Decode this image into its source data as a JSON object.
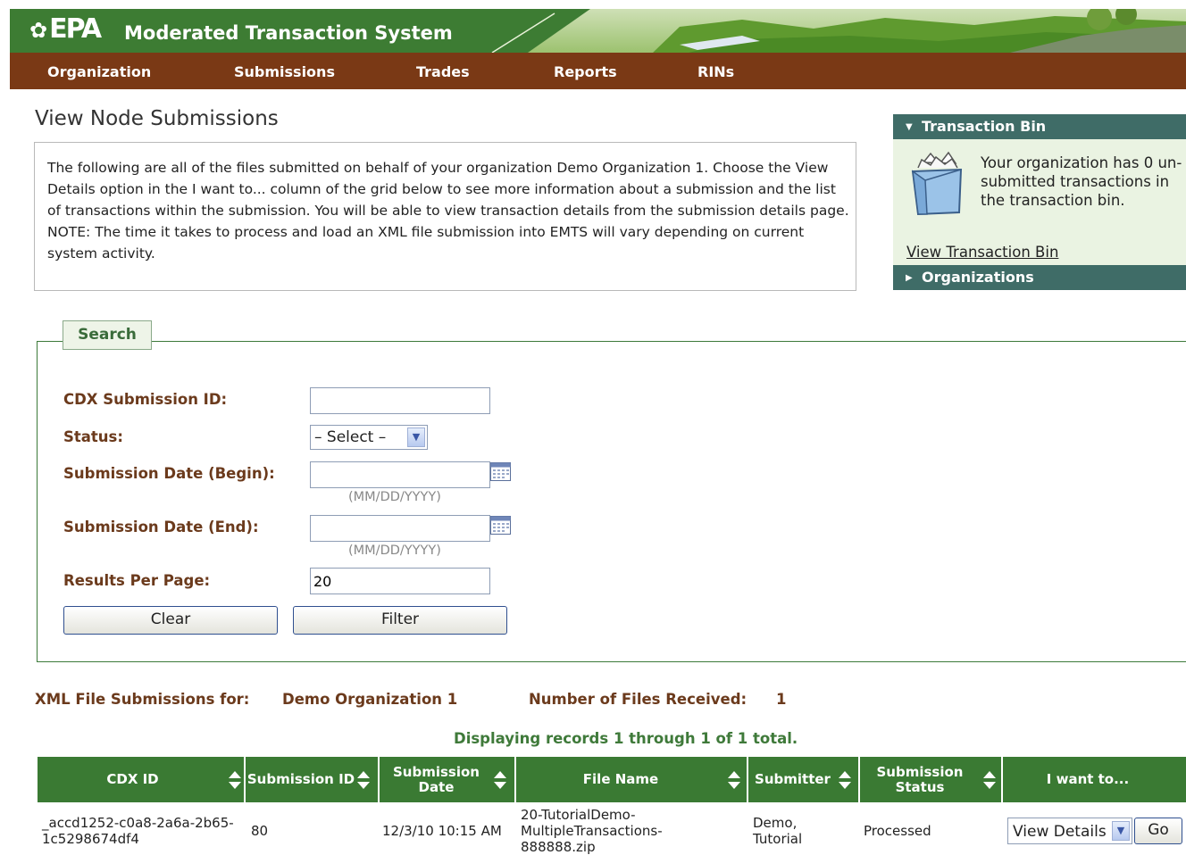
{
  "header": {
    "logo_text": "EPA",
    "app_title": "Moderated Transaction System"
  },
  "nav": {
    "items": [
      {
        "label": "Organization"
      },
      {
        "label": "Submissions"
      },
      {
        "label": "Trades"
      },
      {
        "label": "Reports"
      },
      {
        "label": "RINs"
      }
    ]
  },
  "page": {
    "title": "View Node Submissions",
    "intro": "The following are all of the files submitted on behalf of your organization Demo Organization 1. Choose the View Details option in the I want to... column of the grid below to see more information about a submission and the list of transactions within the submission. You will be able to view transaction details from the submission details page. NOTE: The time it takes to process and load an XML file submission into EMTS will vary depending on current system activity."
  },
  "sidebar": {
    "transaction_bin": {
      "title": "Transaction Bin",
      "message": "Your organization has 0 un-submitted transactions in the transaction bin.",
      "link": "View Transaction Bin"
    },
    "organizations": {
      "title": "Organizations"
    }
  },
  "search": {
    "legend": "Search",
    "cdx_label": "CDX Submission ID:",
    "cdx_value": "",
    "status_label": "Status:",
    "status_value": "– Select –",
    "begin_label": "Submission Date (Begin):",
    "begin_value": "",
    "end_label": "Submission Date (End):",
    "end_value": "",
    "date_hint": "(MM/DD/YYYY)",
    "results_label": "Results Per Page:",
    "results_value": "20",
    "clear_label": "Clear",
    "filter_label": "Filter"
  },
  "summary": {
    "for_label": "XML File Submissions for:",
    "org_name": "Demo Organization 1",
    "count_label": "Number of Files Received:",
    "count_value": "1",
    "display_text": "Displaying records 1 through 1 of 1 total."
  },
  "table": {
    "columns": [
      {
        "label": "CDX ID"
      },
      {
        "label": "Submission ID"
      },
      {
        "label": "Submission Date"
      },
      {
        "label": "File Name"
      },
      {
        "label": "Submitter"
      },
      {
        "label": "Submission Status"
      },
      {
        "label": "I want to..."
      }
    ],
    "rows": [
      {
        "cdx_id": "_accd1252-c0a8-2a6a-2b65-1c5298674df4",
        "submission_id": "80",
        "submission_date": "12/3/10 10:15 AM",
        "file_name": "20-TutorialDemo-MultipleTransactions-888888.zip",
        "submitter": "Demo, Tutorial",
        "status": "Processed",
        "action": "View Details",
        "go_label": "Go"
      }
    ]
  },
  "colors": {
    "header_green": "#3d7c33",
    "nav_brown": "#7a3915",
    "panel_teal": "#3f6c67",
    "label_brown": "#6b3a1c",
    "table_green": "#3a7a33"
  }
}
